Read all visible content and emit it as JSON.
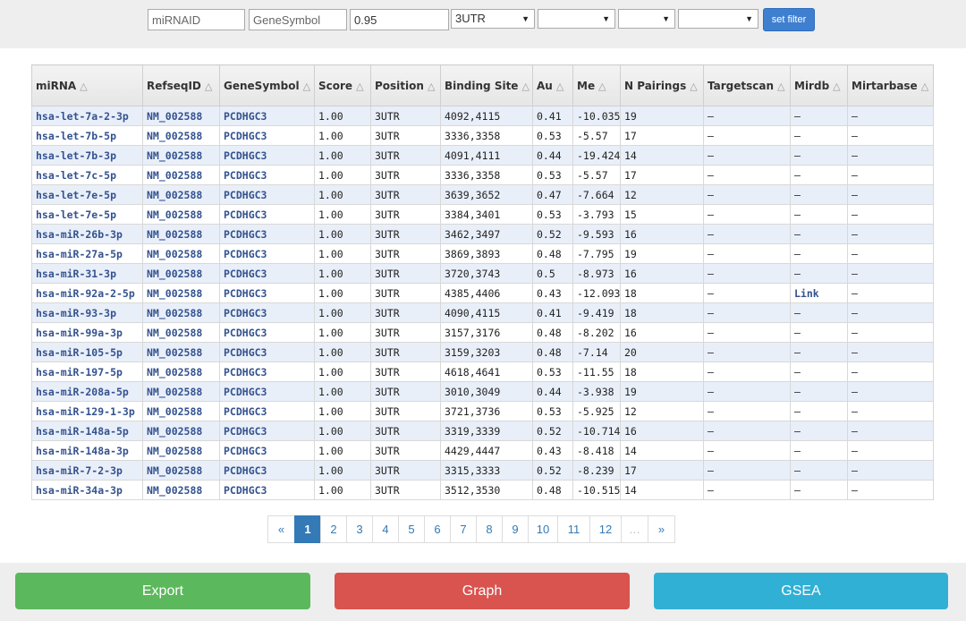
{
  "filters": {
    "mirna_placeholder": "miRNAID",
    "gene_placeholder": "GeneSymbol",
    "score_value": "0.95",
    "position_value": "3UTR",
    "select2_value": "",
    "select3_value": "",
    "select4_value": "",
    "set_filter_label": "set filter"
  },
  "table": {
    "columns": [
      "miRNA",
      "RefseqID",
      "GeneSymbol",
      "Score",
      "Position",
      "Binding Site",
      "Au",
      "Me",
      "N Pairings",
      "Targetscan",
      "Mirdb",
      "Mirtarbase"
    ],
    "sort_icon": "△",
    "rows": [
      [
        "hsa-let-7a-2-3p",
        "NM_002588",
        "PCDHGC3",
        "1.00",
        "3UTR",
        "4092,4115",
        "0.41",
        "-10.035",
        "19",
        "—",
        "—",
        "—"
      ],
      [
        "hsa-let-7b-5p",
        "NM_002588",
        "PCDHGC3",
        "1.00",
        "3UTR",
        "3336,3358",
        "0.53",
        "-5.57",
        "17",
        "—",
        "—",
        "—"
      ],
      [
        "hsa-let-7b-3p",
        "NM_002588",
        "PCDHGC3",
        "1.00",
        "3UTR",
        "4091,4111",
        "0.44",
        "-19.424",
        "14",
        "—",
        "—",
        "—"
      ],
      [
        "hsa-let-7c-5p",
        "NM_002588",
        "PCDHGC3",
        "1.00",
        "3UTR",
        "3336,3358",
        "0.53",
        "-5.57",
        "17",
        "—",
        "—",
        "—"
      ],
      [
        "hsa-let-7e-5p",
        "NM_002588",
        "PCDHGC3",
        "1.00",
        "3UTR",
        "3639,3652",
        "0.47",
        "-7.664",
        "12",
        "—",
        "—",
        "—"
      ],
      [
        "hsa-let-7e-5p",
        "NM_002588",
        "PCDHGC3",
        "1.00",
        "3UTR",
        "3384,3401",
        "0.53",
        "-3.793",
        "15",
        "—",
        "—",
        "—"
      ],
      [
        "hsa-miR-26b-3p",
        "NM_002588",
        "PCDHGC3",
        "1.00",
        "3UTR",
        "3462,3497",
        "0.52",
        "-9.593",
        "16",
        "—",
        "—",
        "—"
      ],
      [
        "hsa-miR-27a-5p",
        "NM_002588",
        "PCDHGC3",
        "1.00",
        "3UTR",
        "3869,3893",
        "0.48",
        "-7.795",
        "19",
        "—",
        "—",
        "—"
      ],
      [
        "hsa-miR-31-3p",
        "NM_002588",
        "PCDHGC3",
        "1.00",
        "3UTR",
        "3720,3743",
        "0.5",
        "-8.973",
        "16",
        "—",
        "—",
        "—"
      ],
      [
        "hsa-miR-92a-2-5p",
        "NM_002588",
        "PCDHGC3",
        "1.00",
        "3UTR",
        "4385,4406",
        "0.43",
        "-12.093",
        "18",
        "—",
        "Link",
        "—"
      ],
      [
        "hsa-miR-93-3p",
        "NM_002588",
        "PCDHGC3",
        "1.00",
        "3UTR",
        "4090,4115",
        "0.41",
        "-9.419",
        "18",
        "—",
        "—",
        "—"
      ],
      [
        "hsa-miR-99a-3p",
        "NM_002588",
        "PCDHGC3",
        "1.00",
        "3UTR",
        "3157,3176",
        "0.48",
        "-8.202",
        "16",
        "—",
        "—",
        "—"
      ],
      [
        "hsa-miR-105-5p",
        "NM_002588",
        "PCDHGC3",
        "1.00",
        "3UTR",
        "3159,3203",
        "0.48",
        "-7.14",
        "20",
        "—",
        "—",
        "—"
      ],
      [
        "hsa-miR-197-5p",
        "NM_002588",
        "PCDHGC3",
        "1.00",
        "3UTR",
        "4618,4641",
        "0.53",
        "-11.55",
        "18",
        "—",
        "—",
        "—"
      ],
      [
        "hsa-miR-208a-5p",
        "NM_002588",
        "PCDHGC3",
        "1.00",
        "3UTR",
        "3010,3049",
        "0.44",
        "-3.938",
        "19",
        "—",
        "—",
        "—"
      ],
      [
        "hsa-miR-129-1-3p",
        "NM_002588",
        "PCDHGC3",
        "1.00",
        "3UTR",
        "3721,3736",
        "0.53",
        "-5.925",
        "12",
        "—",
        "—",
        "—"
      ],
      [
        "hsa-miR-148a-5p",
        "NM_002588",
        "PCDHGC3",
        "1.00",
        "3UTR",
        "3319,3339",
        "0.52",
        "-10.714",
        "16",
        "—",
        "—",
        "—"
      ],
      [
        "hsa-miR-148a-3p",
        "NM_002588",
        "PCDHGC3",
        "1.00",
        "3UTR",
        "4429,4447",
        "0.43",
        "-8.418",
        "14",
        "—",
        "—",
        "—"
      ],
      [
        "hsa-miR-7-2-3p",
        "NM_002588",
        "PCDHGC3",
        "1.00",
        "3UTR",
        "3315,3333",
        "0.52",
        "-8.239",
        "17",
        "—",
        "—",
        "—"
      ],
      [
        "hsa-miR-34a-3p",
        "NM_002588",
        "PCDHGC3",
        "1.00",
        "3UTR",
        "3512,3530",
        "0.48",
        "-10.515",
        "14",
        "—",
        "—",
        "—"
      ]
    ]
  },
  "pagination": {
    "items": [
      "«",
      "1",
      "2",
      "3",
      "4",
      "5",
      "6",
      "7",
      "8",
      "9",
      "10",
      "11",
      "12",
      "…",
      "»"
    ],
    "active": "1"
  },
  "actions": {
    "export_label": "Export",
    "graph_label": "Graph",
    "gsea_label": "GSEA"
  },
  "colors": {
    "export": "#5cb85c",
    "graph": "#d9534f",
    "gsea": "#31b0d5",
    "link": "#33528f",
    "accent": "#337ab7"
  }
}
